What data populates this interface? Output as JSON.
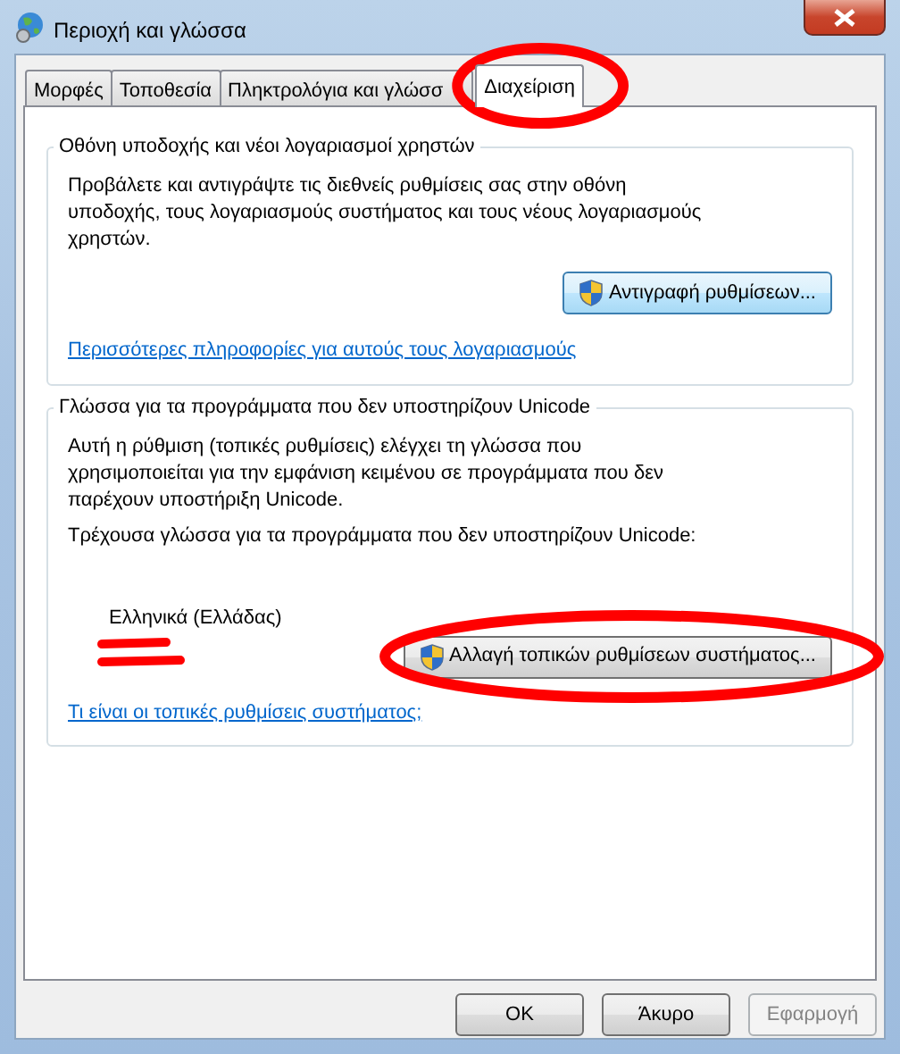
{
  "window": {
    "title": "Περιοχή και γλώσσα"
  },
  "tabs": [
    {
      "label": "Μορφές",
      "selected": false
    },
    {
      "label": "Τοποθεσία",
      "selected": false
    },
    {
      "label": "Πληκτρολόγια και γλώσσ",
      "selected": false
    },
    {
      "label": "Διαχείριση",
      "selected": true
    }
  ],
  "groups": [
    {
      "title": "Οθόνη υποδοχής και νέοι λογαριασμοί χρηστών",
      "description": "Προβάλετε και αντιγράψτε τις διεθνείς ρυθμίσεις σας στην οθόνη υποδοχής, τους λογαριασμούς συστήματος και τους νέους λογαριασμούς χρηστών.",
      "button": "Αντιγραφή ρυθμίσεων...",
      "link": "Περισσότερες πληροφορίες για αυτούς τους λογαριασμούς"
    },
    {
      "title": "Γλώσσα για τα προγράμματα που δεν υποστηρίζουν Unicode",
      "description": "Αυτή η ρύθμιση (τοπικές ρυθμίσεις) ελέγχει τη γλώσσα που χρησιμοποιείται για την εμφάνιση κειμένου σε προγράμματα που δεν παρέχουν υποστήριξη Unicode.",
      "current_label": "Τρέχουσα γλώσσα για τα προγράμματα που δεν υποστηρίζουν Unicode:",
      "current_value": "Ελληνικά (Ελλάδας)",
      "button": "Αλλαγή τοπικών ρυθμίσεων συστήματος...",
      "link": "Τι είναι οι τοπικές ρυθμίσεις συστήματος;"
    }
  ],
  "buttons": [
    {
      "label": "OK",
      "disabled": false
    },
    {
      "label": "Άκυρο",
      "disabled": false
    },
    {
      "label": "Εφαρμογή",
      "disabled": true
    }
  ]
}
